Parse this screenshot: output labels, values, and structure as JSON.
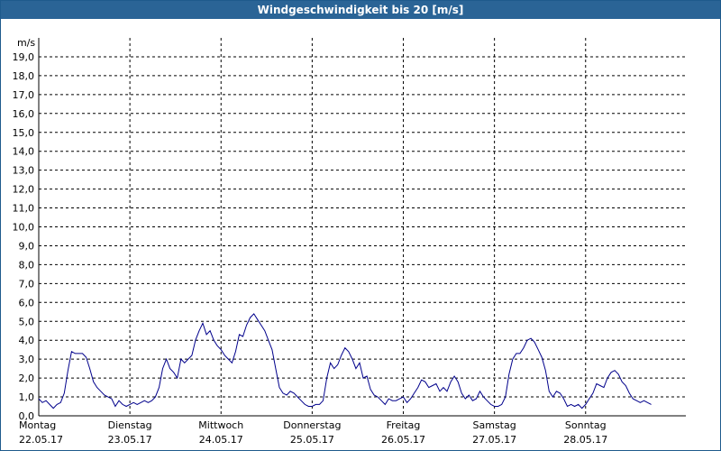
{
  "window": {
    "title": "Windgeschwindigkeit bis 20 [m/s]"
  },
  "chart_data": {
    "type": "line",
    "title": "Windgeschwindigkeit bis 20 [m/s]",
    "ylabel": "m/s",
    "ylim": [
      0,
      20
    ],
    "y_ticks": [
      "0,0",
      "1,0",
      "2,0",
      "3,0",
      "4,0",
      "5,0",
      "6,0",
      "7,0",
      "8,0",
      "9,0",
      "10,0",
      "11,0",
      "12,0",
      "13,0",
      "14,0",
      "15,0",
      "16,0",
      "17,0",
      "18,0",
      "19,0"
    ],
    "xlim": [
      0,
      7.1
    ],
    "x_ticks": [
      {
        "x": 0,
        "day": "Montag",
        "date": "22.05.17"
      },
      {
        "x": 1,
        "day": "Dienstag",
        "date": "23.05.17"
      },
      {
        "x": 2,
        "day": "Mittwoch",
        "date": "24.05.17"
      },
      {
        "x": 3,
        "day": "Donnerstag",
        "date": "25.05.17"
      },
      {
        "x": 4,
        "day": "Freitag",
        "date": "26.05.17"
      },
      {
        "x": 5,
        "day": "Samstag",
        "date": "27.05.17"
      },
      {
        "x": 6,
        "day": "Sonntag",
        "date": "28.05.17"
      }
    ],
    "grid": true,
    "color": "#00008b",
    "series": [
      {
        "points": [
          [
            0.0,
            0.9
          ],
          [
            0.04,
            0.7
          ],
          [
            0.08,
            0.8
          ],
          [
            0.12,
            0.6
          ],
          [
            0.16,
            0.4
          ],
          [
            0.2,
            0.6
          ],
          [
            0.24,
            0.7
          ],
          [
            0.28,
            1.2
          ],
          [
            0.32,
            2.4
          ],
          [
            0.36,
            3.4
          ],
          [
            0.4,
            3.3
          ],
          [
            0.44,
            3.3
          ],
          [
            0.48,
            3.3
          ],
          [
            0.52,
            3.1
          ],
          [
            0.56,
            2.5
          ],
          [
            0.6,
            1.8
          ],
          [
            0.64,
            1.5
          ],
          [
            0.68,
            1.3
          ],
          [
            0.72,
            1.1
          ],
          [
            0.76,
            1.0
          ],
          [
            0.8,
            0.9
          ],
          [
            0.84,
            0.5
          ],
          [
            0.88,
            0.8
          ],
          [
            0.92,
            0.6
          ],
          [
            0.96,
            0.5
          ],
          [
            1.0,
            0.6
          ],
          [
            1.04,
            0.7
          ],
          [
            1.08,
            0.6
          ],
          [
            1.12,
            0.7
          ],
          [
            1.16,
            0.8
          ],
          [
            1.2,
            0.7
          ],
          [
            1.24,
            0.8
          ],
          [
            1.28,
            1.0
          ],
          [
            1.32,
            1.5
          ],
          [
            1.36,
            2.5
          ],
          [
            1.4,
            3.0
          ],
          [
            1.44,
            2.5
          ],
          [
            1.48,
            2.3
          ],
          [
            1.52,
            2.0
          ],
          [
            1.56,
            3.0
          ],
          [
            1.6,
            2.8
          ],
          [
            1.64,
            3.0
          ],
          [
            1.68,
            3.2
          ],
          [
            1.72,
            4.0
          ],
          [
            1.76,
            4.5
          ],
          [
            1.8,
            4.9
          ],
          [
            1.84,
            4.3
          ],
          [
            1.88,
            4.5
          ],
          [
            1.92,
            4.0
          ],
          [
            1.96,
            3.7
          ],
          [
            2.0,
            3.5
          ],
          [
            2.04,
            3.2
          ],
          [
            2.08,
            3.0
          ],
          [
            2.12,
            2.8
          ],
          [
            2.16,
            3.4
          ],
          [
            2.2,
            4.3
          ],
          [
            2.24,
            4.2
          ],
          [
            2.28,
            4.8
          ],
          [
            2.32,
            5.2
          ],
          [
            2.36,
            5.4
          ],
          [
            2.4,
            5.1
          ],
          [
            2.44,
            4.8
          ],
          [
            2.48,
            4.5
          ],
          [
            2.52,
            4.0
          ],
          [
            2.56,
            3.5
          ],
          [
            2.6,
            2.5
          ],
          [
            2.64,
            1.5
          ],
          [
            2.68,
            1.2
          ],
          [
            2.72,
            1.1
          ],
          [
            2.76,
            1.3
          ],
          [
            2.8,
            1.2
          ],
          [
            2.84,
            1.0
          ],
          [
            2.88,
            0.8
          ],
          [
            2.92,
            0.6
          ],
          [
            2.96,
            0.5
          ],
          [
            3.0,
            0.5
          ],
          [
            3.04,
            0.6
          ],
          [
            3.08,
            0.6
          ],
          [
            3.12,
            0.8
          ],
          [
            3.16,
            2.0
          ],
          [
            3.2,
            2.8
          ],
          [
            3.24,
            2.5
          ],
          [
            3.28,
            2.7
          ],
          [
            3.32,
            3.2
          ],
          [
            3.36,
            3.6
          ],
          [
            3.4,
            3.4
          ],
          [
            3.44,
            3.0
          ],
          [
            3.48,
            2.5
          ],
          [
            3.52,
            2.8
          ],
          [
            3.56,
            2.0
          ],
          [
            3.6,
            2.1
          ],
          [
            3.64,
            1.4
          ],
          [
            3.68,
            1.1
          ],
          [
            3.72,
            1.0
          ],
          [
            3.76,
            0.8
          ],
          [
            3.8,
            0.6
          ],
          [
            3.84,
            0.9
          ],
          [
            3.88,
            0.8
          ],
          [
            3.92,
            0.8
          ],
          [
            3.96,
            0.9
          ],
          [
            4.0,
            1.0
          ],
          [
            4.04,
            0.7
          ],
          [
            4.08,
            0.9
          ],
          [
            4.12,
            1.2
          ],
          [
            4.16,
            1.5
          ],
          [
            4.2,
            1.9
          ],
          [
            4.24,
            1.8
          ],
          [
            4.28,
            1.5
          ],
          [
            4.32,
            1.6
          ],
          [
            4.36,
            1.7
          ],
          [
            4.4,
            1.3
          ],
          [
            4.44,
            1.5
          ],
          [
            4.48,
            1.3
          ],
          [
            4.52,
            1.8
          ],
          [
            4.56,
            2.1
          ],
          [
            4.6,
            1.8
          ],
          [
            4.64,
            1.2
          ],
          [
            4.68,
            0.9
          ],
          [
            4.72,
            1.1
          ],
          [
            4.76,
            0.8
          ],
          [
            4.8,
            0.9
          ],
          [
            4.84,
            1.3
          ],
          [
            4.88,
            1.0
          ],
          [
            4.92,
            0.8
          ],
          [
            4.96,
            0.6
          ],
          [
            5.0,
            0.5
          ],
          [
            5.04,
            0.5
          ],
          [
            5.08,
            0.6
          ],
          [
            5.12,
            1.0
          ],
          [
            5.16,
            2.2
          ],
          [
            5.2,
            3.0
          ],
          [
            5.24,
            3.3
          ],
          [
            5.28,
            3.3
          ],
          [
            5.32,
            3.6
          ],
          [
            5.36,
            4.0
          ],
          [
            5.4,
            4.1
          ],
          [
            5.44,
            3.9
          ],
          [
            5.48,
            3.5
          ],
          [
            5.52,
            3.1
          ],
          [
            5.56,
            2.4
          ],
          [
            5.6,
            1.3
          ],
          [
            5.64,
            1.0
          ],
          [
            5.68,
            1.3
          ],
          [
            5.72,
            1.2
          ],
          [
            5.76,
            0.9
          ],
          [
            5.8,
            0.5
          ],
          [
            5.84,
            0.6
          ],
          [
            5.88,
            0.5
          ],
          [
            5.92,
            0.6
          ],
          [
            5.96,
            0.4
          ],
          [
            6.0,
            0.6
          ],
          [
            6.04,
            0.9
          ],
          [
            6.08,
            1.2
          ],
          [
            6.12,
            1.7
          ],
          [
            6.16,
            1.6
          ],
          [
            6.2,
            1.5
          ],
          [
            6.24,
            2.0
          ],
          [
            6.28,
            2.3
          ],
          [
            6.32,
            2.4
          ],
          [
            6.36,
            2.2
          ],
          [
            6.4,
            1.8
          ],
          [
            6.44,
            1.6
          ],
          [
            6.48,
            1.2
          ],
          [
            6.52,
            0.9
          ],
          [
            6.56,
            0.8
          ],
          [
            6.6,
            0.7
          ],
          [
            6.64,
            0.8
          ],
          [
            6.68,
            0.7
          ],
          [
            6.72,
            0.6
          ]
        ]
      }
    ]
  }
}
